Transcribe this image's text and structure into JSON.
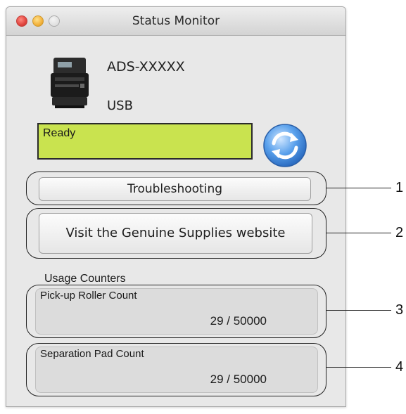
{
  "window": {
    "title": "Status Monitor"
  },
  "device": {
    "icon": "scanner-icon",
    "name": "ADS-XXXXX",
    "connection": "USB"
  },
  "status": {
    "text": "Ready",
    "color": "#c9e34f"
  },
  "refresh_icon": "refresh-icon",
  "buttons": {
    "troubleshooting": "Troubleshooting",
    "supplies": "Visit the Genuine Supplies website"
  },
  "usage": {
    "heading": "Usage Counters",
    "pickup": {
      "label": "Pick-up Roller Count",
      "value": "29 / 50000"
    },
    "separation": {
      "label": "Separation Pad Count",
      "value": "29 / 50000"
    }
  },
  "callouts": [
    "1",
    "2",
    "3",
    "4"
  ]
}
